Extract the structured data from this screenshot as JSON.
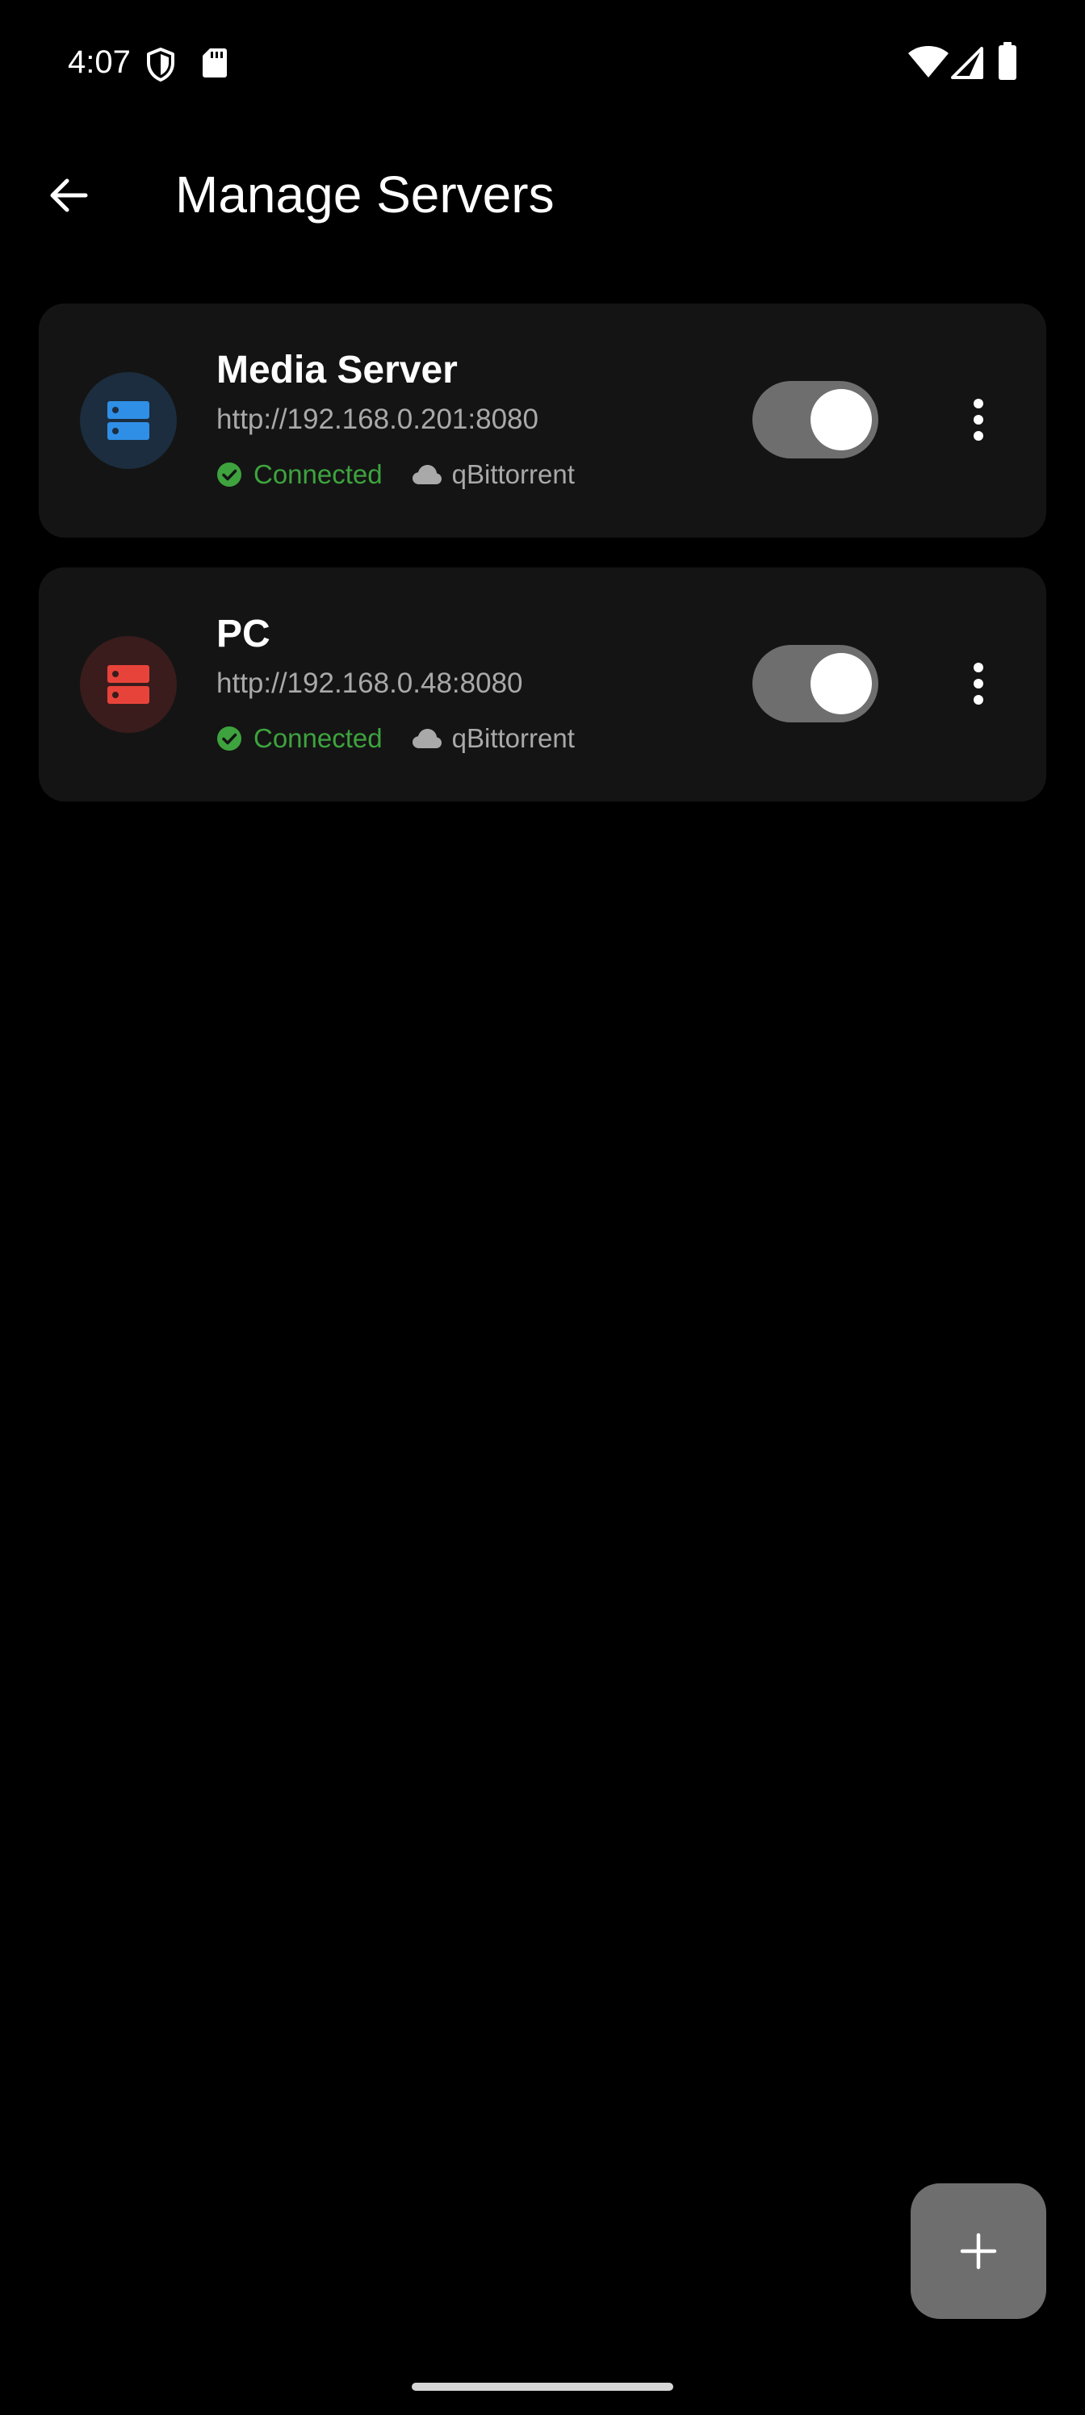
{
  "status_bar": {
    "time": "4:07",
    "icons": [
      "shield-icon",
      "sd-card-icon",
      "wifi-icon",
      "cellular-signal-icon",
      "battery-icon"
    ]
  },
  "app_bar": {
    "title": "Manage Servers",
    "back_icon": "arrow-back-icon"
  },
  "servers": [
    {
      "name": "Media Server",
      "url": "http://192.168.0.201:8080",
      "status": "Connected",
      "client": "qBittorrent",
      "enabled": true,
      "icon": "server-icon",
      "icon_color": "#2f8fe6",
      "icon_bg": "#1b2d3e"
    },
    {
      "name": "PC",
      "url": "http://192.168.0.48:8080",
      "status": "Connected",
      "client": "qBittorrent",
      "enabled": true,
      "icon": "server-icon",
      "icon_color": "#e8433a",
      "icon_bg": "#3a1c1c"
    }
  ],
  "fab": {
    "icon": "plus-icon"
  },
  "colors": {
    "background": "#000000",
    "card": "#141414",
    "connected": "#3ea33e",
    "secondary_text": "#a9a9a9",
    "toggle_track": "#6e6e6e",
    "fab": "#6e6e6e"
  }
}
